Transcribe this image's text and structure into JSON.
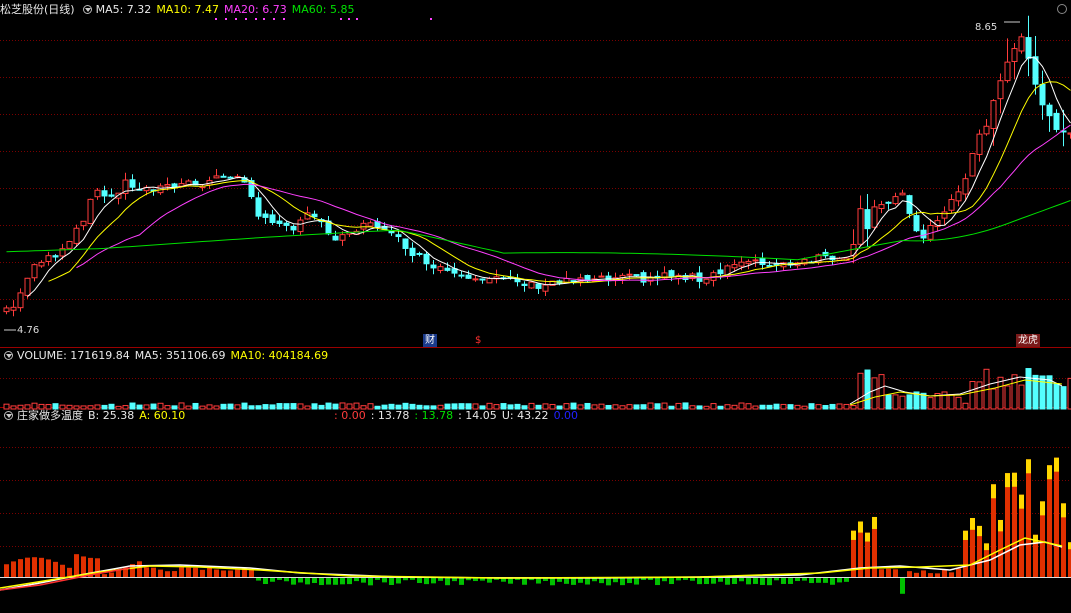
{
  "header": {
    "title": "松芝股份(日线)",
    "ma5": "MA5: 7.32",
    "ma10": "MA10: 7.47",
    "ma20": "MA20: 6.73",
    "ma60": "MA60: 5.85"
  },
  "volume_header": {
    "label": "VOLUME: 171619.84",
    "ma5": "MA5: 351106.69",
    "ma10": "MA10: 404184.69"
  },
  "indicator_header": {
    "label": "庄家做多温度",
    "b": "B: 25.38",
    "a": "A: 60.10",
    "v1": ": 0.00",
    "v2": ": 13.78",
    "v3": ": 13.78",
    "v4": ": 14.05",
    "u": "U: 43.22",
    "v5": "0.00"
  },
  "price_marks": {
    "high": "8.65",
    "low": "4.76"
  },
  "event_tags": {
    "cai": "财",
    "dollar": "$",
    "lhb": "龙虎"
  },
  "colors": {
    "up": "#ff3c3c",
    "down": "#54ffff",
    "ma5": "#ffffff",
    "ma10": "#ffff00",
    "ma20": "#ff40ff",
    "ma60": "#00e000",
    "grid": "#7a0000"
  },
  "chart_data": [
    {
      "type": "candlestick",
      "title": "松芝股份(日线)",
      "series": [
        "MA5",
        "MA10",
        "MA20",
        "MA60"
      ],
      "current": {
        "MA5": 7.32,
        "MA10": 7.47,
        "MA20": 6.73,
        "MA60": 5.85
      },
      "price_high": 8.65,
      "price_low": 4.76,
      "ylim": [
        4.6,
        8.8
      ]
    },
    {
      "type": "bar",
      "title": "VOLUME",
      "current": {
        "VOLUME": 171619.84,
        "MA5": 351106.69,
        "MA10": 404184.69
      }
    },
    {
      "type": "bar",
      "title": "庄家做多温度",
      "current": {
        "B": 25.38,
        "A": 60.1,
        "U": 43.22
      }
    }
  ]
}
